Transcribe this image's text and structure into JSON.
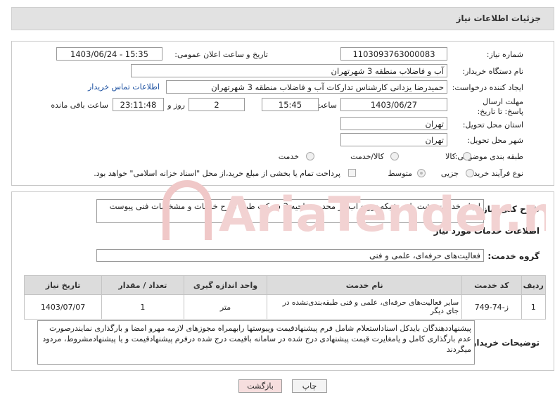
{
  "header": {
    "title": "جزئیات اطلاعات نیاز"
  },
  "form": {
    "need_number_label": "شماره نیاز:",
    "need_number": "1103093763000083",
    "announce_label": "تاریخ و ساعت اعلان عمومی:",
    "announce_value": "1403/06/24 - 15:35",
    "buyer_org_label": "نام دستگاه خریدار:",
    "buyer_org": "آب و فاضلاب منطقه 3 شهرتهران",
    "creator_label": "ایجاد کننده درخواست:",
    "creator": "حمیدرضا یزدانی کارشناس تدارکات آب و فاضلاب منطقه 3 شهرتهران",
    "contact_link": "اطلاعات تماس خریدار",
    "deadline_label": "مهلت ارسال پاسخ: تا تاریخ:",
    "deadline_date": "1403/06/27",
    "time_label": "ساعت",
    "deadline_time": "15:45",
    "days_value": "2",
    "days_label": "روز و",
    "remaining_time": "23:11:48",
    "remaining_label": "ساعت باقی مانده",
    "province_label": "استان محل تحویل:",
    "province": "تهران",
    "city_label": "شهر محل تحویل:",
    "city": "تهران",
    "category_label": "طبقه بندی موضوعی:",
    "category_options": [
      "کالا",
      "کالا/خدمت",
      "خدمت"
    ],
    "process_label": "نوع فرآیند خرید :",
    "process_options": [
      "جزیی",
      "متوسط"
    ],
    "payment_note": "پرداخت تمام یا بخشی از مبلغ خرید،از محل \"اسناد خزانه اسلامی\" خواهد بود."
  },
  "summary": {
    "label": "شرح کلی نیاز:",
    "text": "انجام خدمات نشت یابی شبکه توزیع آب در محدوده ناحیه 2 شرکت طبق شرح خدمات و مشخصات فنی پیوست"
  },
  "services": {
    "section_title": "اطلاعات خدمات مورد نیاز",
    "group_label": "گروه خدمت:",
    "group_value": "فعالیت‌های حرفه‌ای، علمی و فنی",
    "columns": [
      "ردیف",
      "کد خدمت",
      "نام خدمت",
      "واحد اندازه گیری",
      "تعداد / مقدار",
      "تاریخ نیاز"
    ],
    "rows": [
      [
        "1",
        "ز-74-749",
        "سایر فعالیت‌های حرفه‌ای، علمی و فنی طبقه‌بندی‌نشده در جای دیگر",
        "متر",
        "1",
        "1403/07/07"
      ]
    ]
  },
  "buyer_notes": {
    "label": "توضیحات خریدار:",
    "text": "پیشنهاددهندگان بایدکل اسناداستعلام شامل فرم پیشنهادقیمت وپیوستها رابهمراه مجوزهای لازمه مهرو امضا و بارگذاری نمایندرصورت عدم بارگذاری کامل و یامغایرت قیمت پیشنهادی درج شده در سامانه باقیمت درج شده درفرم پیشنهادقیمت و یا پیشنهادمشروط، مردود میگردند"
  },
  "buttons": {
    "print": "چاپ",
    "back": "بازگشت"
  },
  "watermark": {
    "text": "AriaTender.neT"
  },
  "colors": {
    "link": "#1a4fa0",
    "back_button_bg": "#f6dede",
    "header_bg": "#e2e2e2",
    "watermark": "#f0c8c8"
  }
}
